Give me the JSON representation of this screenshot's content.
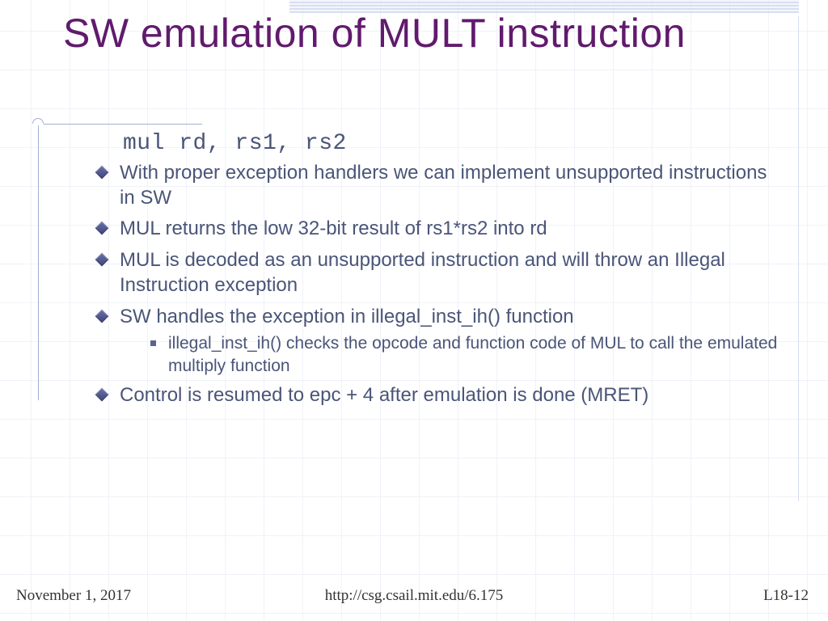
{
  "title": "SW emulation of MULT instruction",
  "instruction": "mul rd, rs1, rs2",
  "bullets": {
    "b0": "With proper exception handlers we can implement unsupported instructions in SW",
    "b1": "MUL returns the low 32-bit result of rs1*rs2 into rd",
    "b2": "MUL is decoded as an unsupported instruction and will throw an Illegal Instruction exception",
    "b3": "SW handles the exception in illegal_inst_ih() function",
    "b3_sub0": "illegal_inst_ih() checks the opcode and function code of MUL to call the emulated multiply function",
    "b4": "Control is resumed to epc + 4 after emulation is done (MRET)"
  },
  "footer": {
    "date": "November 1, 2017",
    "url": "http://csg.csail.mit.edu/6.175",
    "page": "L18-12"
  }
}
